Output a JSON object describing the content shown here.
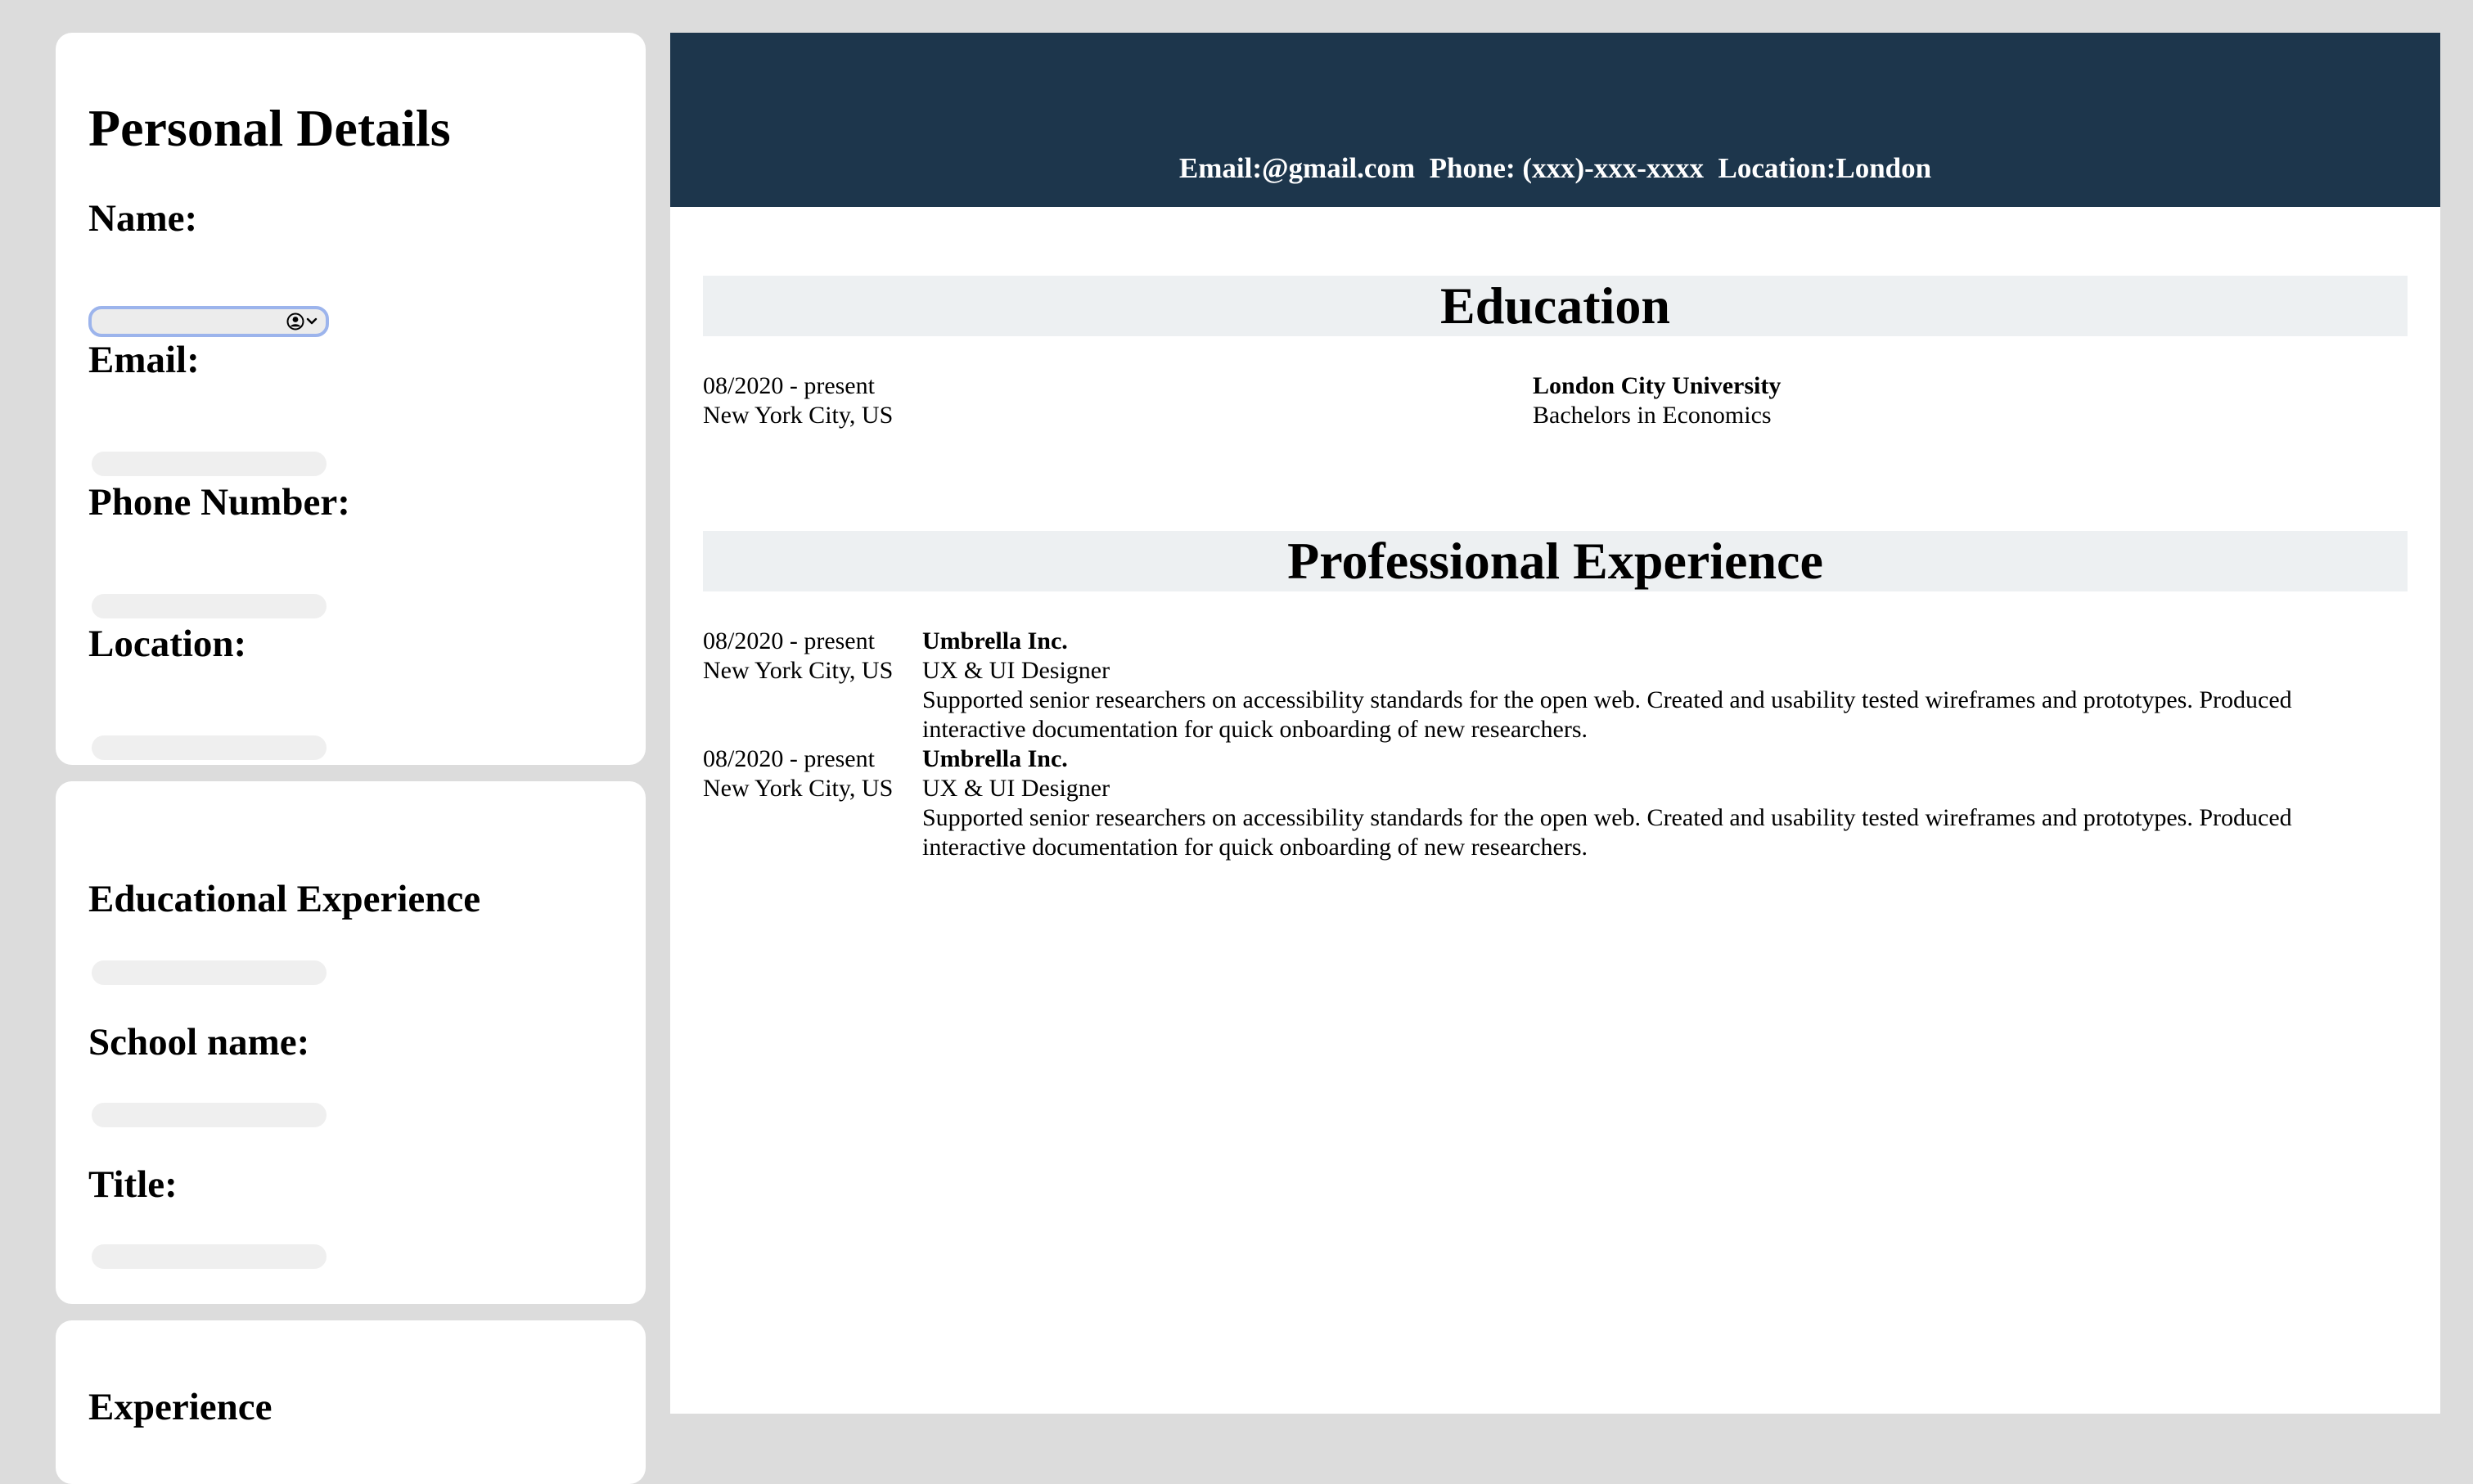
{
  "editor": {
    "personal": {
      "heading": "Personal Details",
      "name_label": "Name:",
      "email_label": "Email:",
      "phone_label": "Phone Number:",
      "location_label": "Location:",
      "name_value": "",
      "email_value": "",
      "phone_value": "",
      "location_value": ""
    },
    "education": {
      "heading": "Educational Experience",
      "education_value": "",
      "school_label": "School name:",
      "school_value": "",
      "title_label": "Title:",
      "title_value": ""
    },
    "experience": {
      "heading": "Experience"
    }
  },
  "resume": {
    "contact": {
      "email": "Email:@gmail.com",
      "phone": "Phone: (xxx)-xxx-xxxx",
      "location": "Location:London"
    },
    "education": {
      "heading": "Education",
      "entries": [
        {
          "dates": "08/2020 - present",
          "place": "New York City, US",
          "school": "London City University",
          "degree": "Bachelors in Economics"
        }
      ]
    },
    "experience": {
      "heading": "Professional Experience",
      "entries": [
        {
          "dates": "08/2020 - present",
          "place": "New York City, US",
          "company": "Umbrella Inc.",
          "role": "UX & UI Designer",
          "description": "Supported senior researchers on accessibility standards for the open web. Created and usability tested wireframes and prototypes. Produced interactive documentation for quick onboarding of new researchers."
        },
        {
          "dates": "08/2020 - present",
          "place": "New York City, US",
          "company": "Umbrella Inc.",
          "role": "UX & UI Designer",
          "description": "Supported senior researchers on accessibility standards for the open web. Created and usability tested wireframes and prototypes. Produced interactive documentation for quick onboarding of new researchers."
        }
      ]
    }
  },
  "icons": {
    "autofill": "contact-card-icon",
    "dropdown": "chevron-down-icon"
  },
  "colors": {
    "page_background": "#dcdcdc",
    "header_background": "#1d364c",
    "section_bar": "#edf0f2",
    "input_background": "#efefef",
    "focus_ring": "#9cb4ec"
  }
}
